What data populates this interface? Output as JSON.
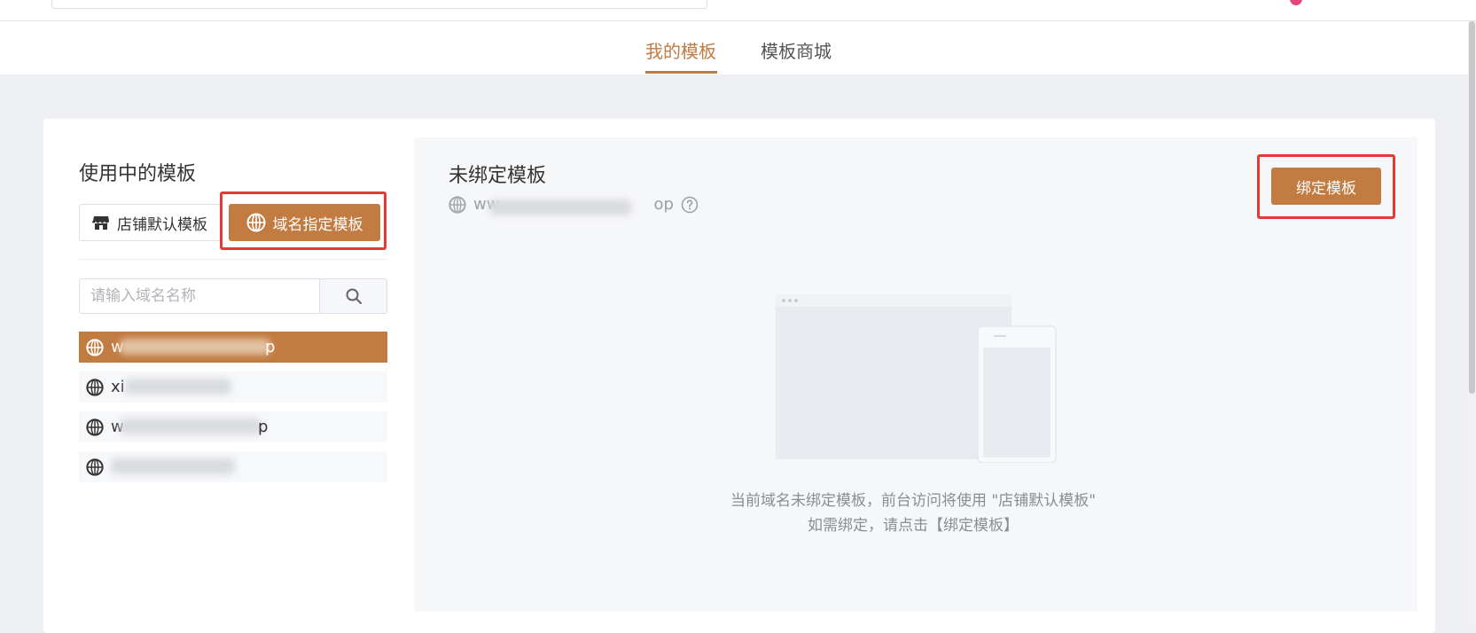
{
  "header": {
    "tabs": [
      {
        "label": "我的模板",
        "active": true
      },
      {
        "label": "模板商城",
        "active": false
      }
    ]
  },
  "left": {
    "title": "使用中的模板",
    "store_default_button": "店铺默认模板",
    "domain_specific_button": "域名指定模板",
    "search": {
      "placeholder": "请输入域名名称",
      "value": ""
    },
    "domains": [
      {
        "label": "w",
        "tail": "p",
        "selected": true
      },
      {
        "label": "xi",
        "tail": "",
        "selected": false
      },
      {
        "label": "w",
        "tail": "p",
        "selected": false
      },
      {
        "label": "",
        "tail": "",
        "selected": false
      }
    ]
  },
  "right": {
    "title": "未绑定模板",
    "domain_prefix": "ww",
    "domain_suffix": "op",
    "bind_button": "绑定模板",
    "empty_line1": "当前域名未绑定模板，前台访问将使用 \"店铺默认模板\"",
    "empty_line2": "如需绑定，请点击【绑定模板】"
  },
  "colors": {
    "accent": "#c27b40",
    "highlight_border": "#e53935",
    "panel_bg": "#f6f7f9"
  },
  "icons": {
    "store": "store-icon",
    "globe": "globe-icon",
    "search": "search-icon",
    "help": "question-circle-icon"
  }
}
